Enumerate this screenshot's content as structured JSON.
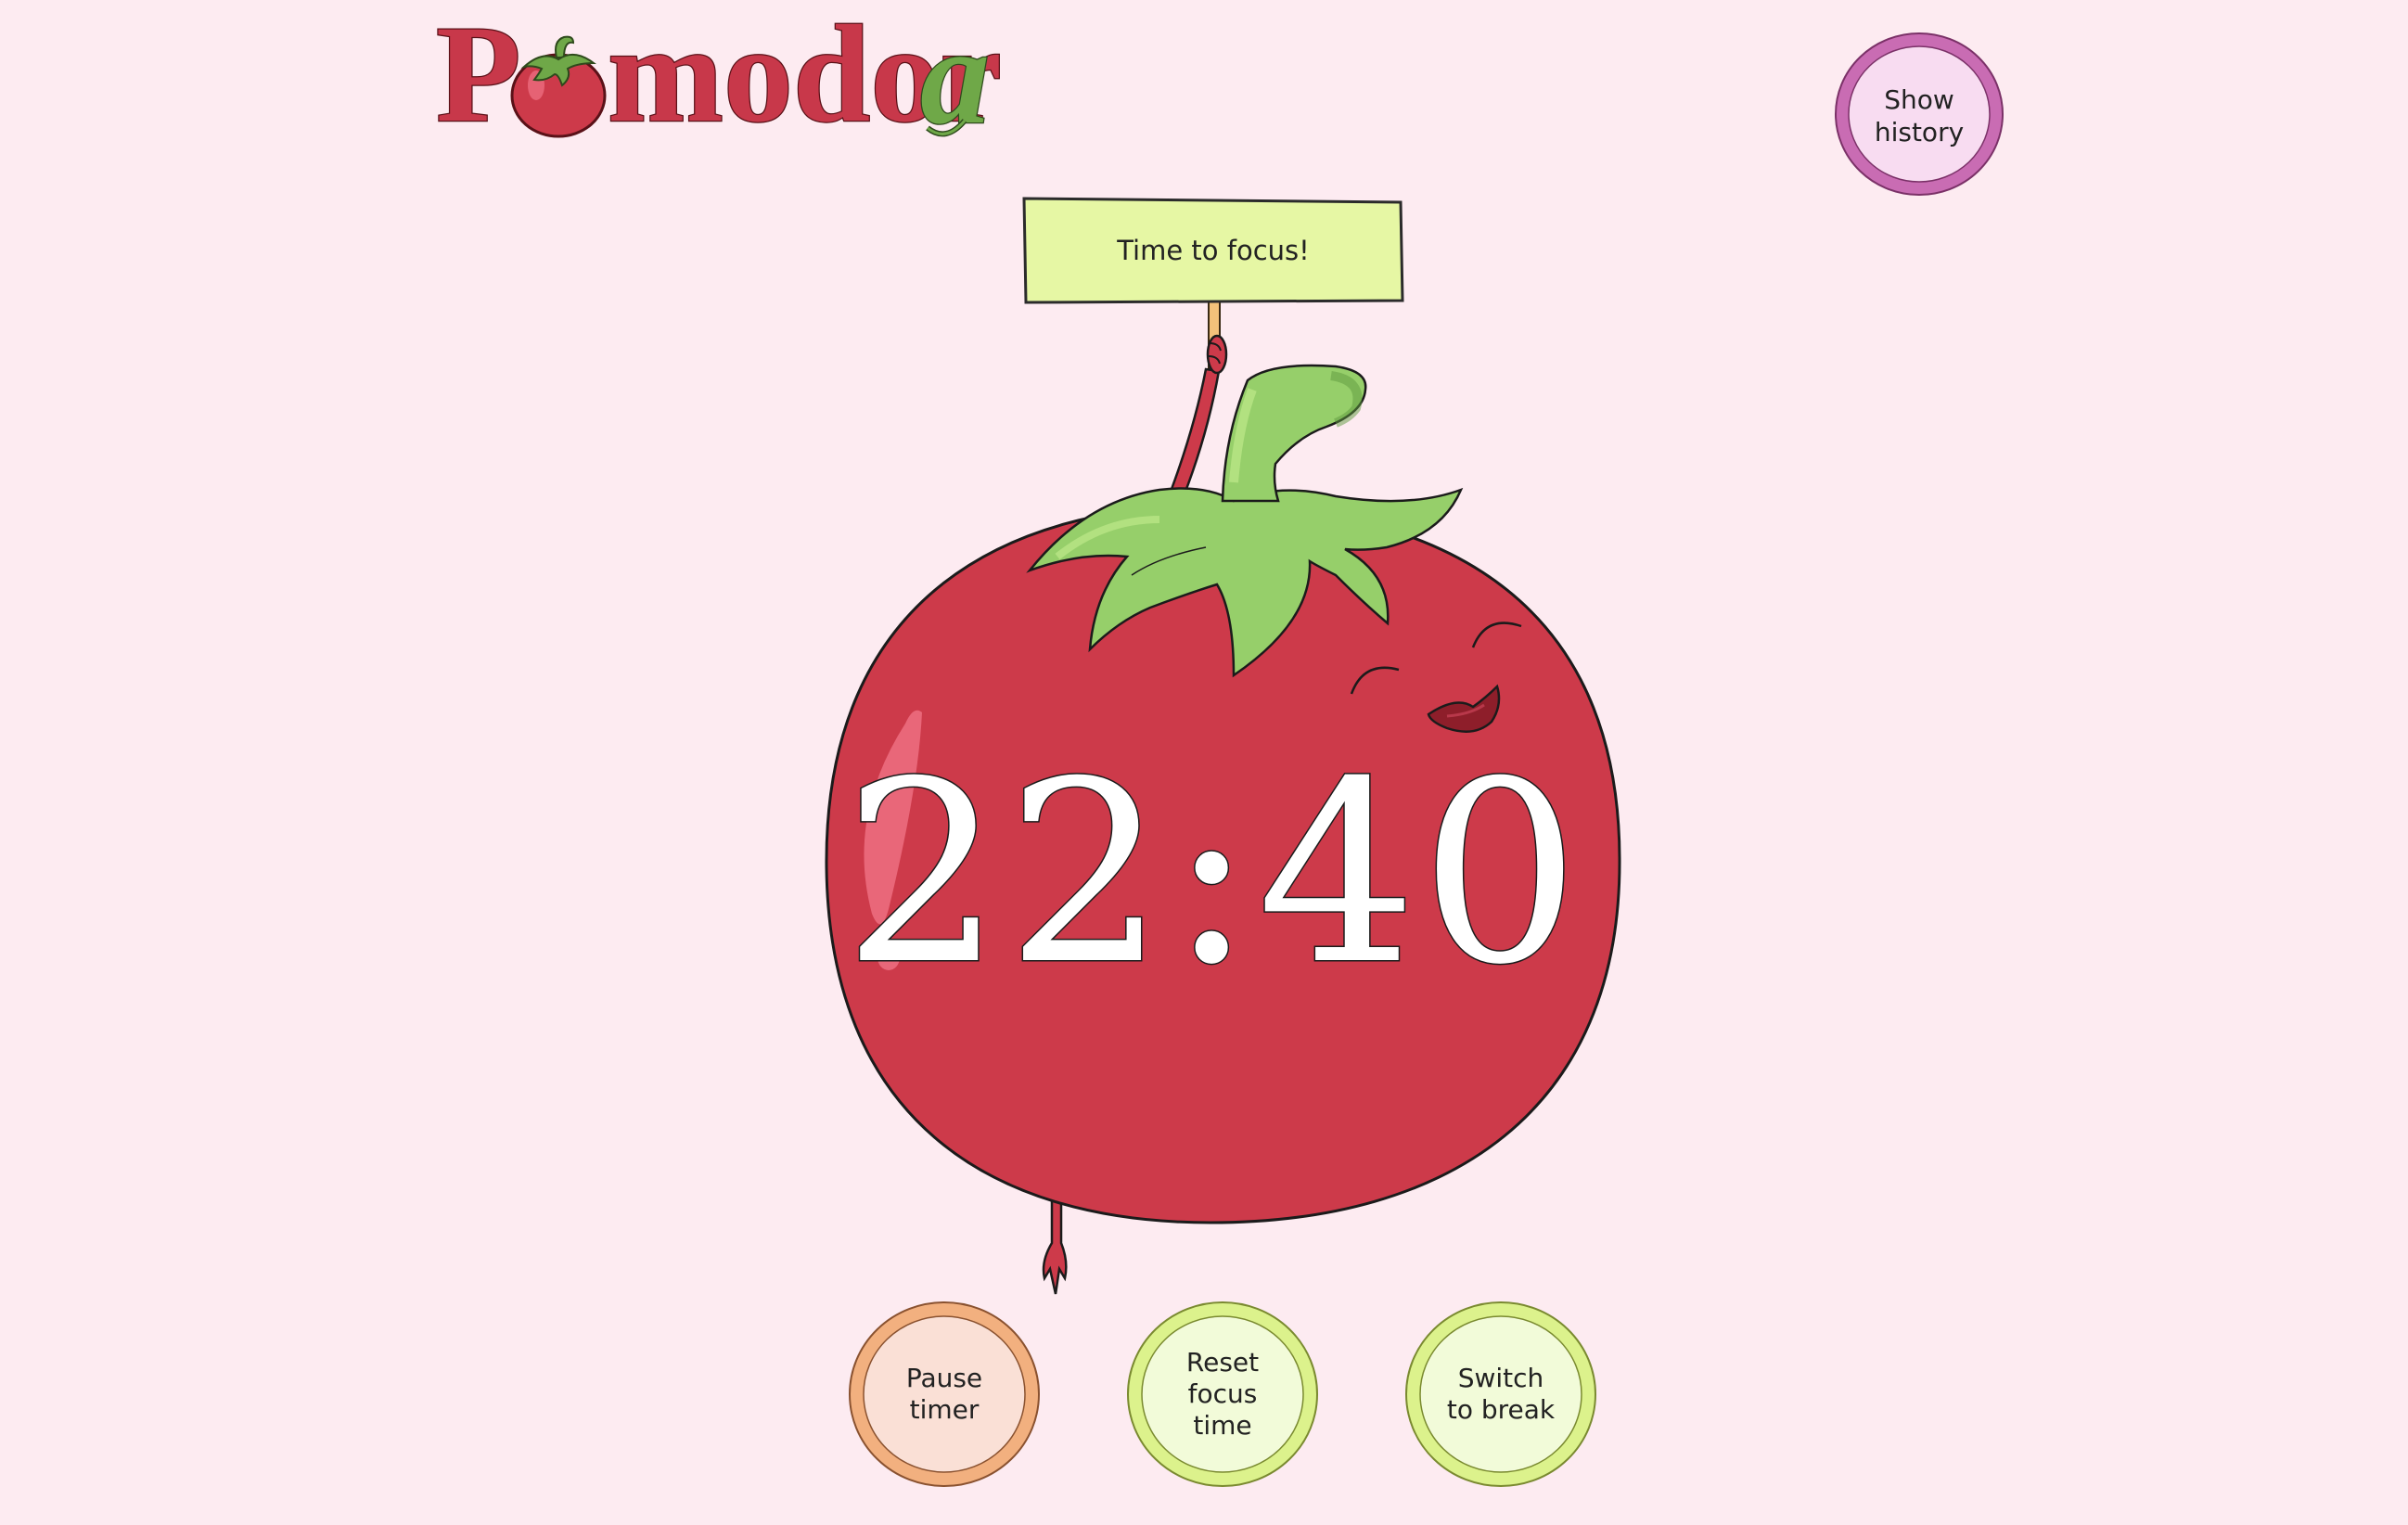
{
  "app": {
    "logo": "Pomodora"
  },
  "sign": {
    "text": "Time to focus!"
  },
  "timer": {
    "display": "22:40"
  },
  "buttons": {
    "history": [
      "Show",
      "history"
    ],
    "pause": [
      "Pause",
      "timer"
    ],
    "reset": [
      "Reset",
      "focus",
      "time"
    ],
    "switch": [
      "Switch",
      "to break"
    ]
  },
  "colors": {
    "background": "#fdebf1",
    "tomato": "#cd3a4a",
    "leaf": "#96cf6a",
    "sign": "#e6f7a4",
    "pause_ring": "#f2b07f",
    "pause_fill": "#fae0d6",
    "green_ring": "#dcf28c",
    "green_fill": "#f2fbd9",
    "history_ring": "#c96cb3",
    "history_fill": "#f8dcf1"
  }
}
